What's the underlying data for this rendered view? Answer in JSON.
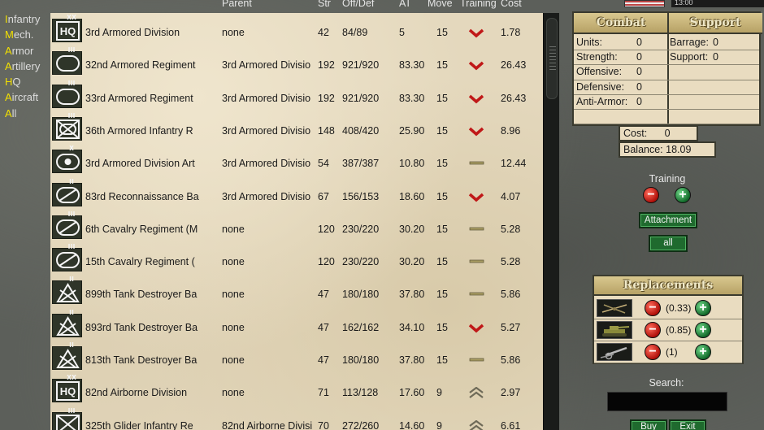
{
  "filters": [
    {
      "hot": "I",
      "rest": "nfantry"
    },
    {
      "hot": "M",
      "rest": "ech."
    },
    {
      "hot": "A",
      "rest": "rmor"
    },
    {
      "hot": "A",
      "rest": "rtillery"
    },
    {
      "hot": "H",
      "rest": "Q"
    },
    {
      "hot": "A",
      "rest": "ircraft"
    },
    {
      "hot": "A",
      "rest": "ll"
    }
  ],
  "header": {
    "parent": "Parent",
    "str": "Str",
    "offdef": "Off/Def",
    "at": "AT",
    "move": "Move",
    "training": "Training",
    "cost": "Cost"
  },
  "units": [
    {
      "name": "3rd Armored Division",
      "parent": "none",
      "str": "42",
      "offdef": "84/89",
      "at": "5",
      "move": "15",
      "training": "down",
      "cost": "1.78",
      "icon": "hq",
      "echelon": "xx"
    },
    {
      "name": "32nd Armored Regiment",
      "parent": "3rd Armored Divisio",
      "str": "192",
      "offdef": "921/920",
      "at": "83.30",
      "move": "15",
      "training": "down",
      "cost": "26.43",
      "icon": "armor",
      "echelon": "iii"
    },
    {
      "name": "33rd Armored Regiment",
      "parent": "3rd Armored Divisio",
      "str": "192",
      "offdef": "921/920",
      "at": "83.30",
      "move": "15",
      "training": "down",
      "cost": "26.43",
      "icon": "armor",
      "echelon": "iii"
    },
    {
      "name": "36th Armored Infantry R",
      "parent": "3rd Armored Divisio",
      "str": "148",
      "offdef": "408/420",
      "at": "25.90",
      "move": "15",
      "training": "down",
      "cost": "8.96",
      "icon": "armored-infantry",
      "echelon": "iii"
    },
    {
      "name": "3rd Armored Division Art",
      "parent": "3rd Armored Divisio",
      "str": "54",
      "offdef": "387/387",
      "at": "10.80",
      "move": "15",
      "training": "flat",
      "cost": "12.44",
      "icon": "artillery",
      "echelon": "x"
    },
    {
      "name": "83rd Reconnaissance Ba",
      "parent": "3rd Armored Divisio",
      "str": "67",
      "offdef": "156/153",
      "at": "18.60",
      "move": "15",
      "training": "down",
      "cost": "4.07",
      "icon": "recon",
      "echelon": "ii"
    },
    {
      "name": "6th Cavalry Regiment (M",
      "parent": "none",
      "str": "120",
      "offdef": "230/220",
      "at": "30.20",
      "move": "15",
      "training": "flat",
      "cost": "5.28",
      "icon": "recon",
      "echelon": "iii"
    },
    {
      "name": "15th Cavalry Regiment (",
      "parent": "none",
      "str": "120",
      "offdef": "230/220",
      "at": "30.20",
      "move": "15",
      "training": "flat",
      "cost": "5.28",
      "icon": "recon",
      "echelon": "iii"
    },
    {
      "name": "899th Tank Destroyer Ba",
      "parent": "none",
      "str": "47",
      "offdef": "180/180",
      "at": "37.80",
      "move": "15",
      "training": "flat",
      "cost": "5.86",
      "icon": "tank-destroyer",
      "echelon": "ii"
    },
    {
      "name": "893rd Tank Destroyer Ba",
      "parent": "none",
      "str": "47",
      "offdef": "162/162",
      "at": "34.10",
      "move": "15",
      "training": "down",
      "cost": "5.27",
      "icon": "tank-destroyer",
      "echelon": "ii"
    },
    {
      "name": "813th Tank Destroyer Ba",
      "parent": "none",
      "str": "47",
      "offdef": "180/180",
      "at": "37.80",
      "move": "15",
      "training": "flat",
      "cost": "5.86",
      "icon": "tank-destroyer",
      "echelon": "ii"
    },
    {
      "name": "82nd Airborne Division",
      "parent": "none",
      "str": "71",
      "offdef": "113/128",
      "at": "17.60",
      "move": "9",
      "training": "up",
      "cost": "2.97",
      "icon": "hq",
      "echelon": "xx"
    },
    {
      "name": "325th Glider Infantry Re",
      "parent": "82nd Airborne Divisi",
      "str": "70",
      "offdef": "272/260",
      "at": "14.60",
      "move": "9",
      "training": "up",
      "cost": "6.61",
      "icon": "infantry",
      "echelon": "iii"
    }
  ],
  "top_readout": "13:00",
  "stats": {
    "combat_title": "Combat",
    "support_title": "Support",
    "combat": [
      {
        "label": "Units:",
        "value": "0"
      },
      {
        "label": "Strength:",
        "value": "0"
      },
      {
        "label": "Offensive:",
        "value": "0"
      },
      {
        "label": "Defensive:",
        "value": "0"
      },
      {
        "label": "Anti-Armor:",
        "value": "0"
      }
    ],
    "support": [
      {
        "label": "Barrage:",
        "value": "0"
      },
      {
        "label": "Support:",
        "value": "0"
      }
    ]
  },
  "cost": {
    "label": "Cost:",
    "value": "0"
  },
  "balance": {
    "label": "Balance:",
    "value": "18.09"
  },
  "training": {
    "label": "Training",
    "minus": "−",
    "plus": "+"
  },
  "buttons": {
    "attachment": "Attachment",
    "all": "all",
    "buy": "Buy",
    "exit": "Exit"
  },
  "replacements": {
    "title": "Replacements",
    "rows": [
      {
        "icon": "infantry-icon",
        "value": "(0.33)"
      },
      {
        "icon": "tank-icon",
        "value": "(0.85)"
      },
      {
        "icon": "artillery-gun-icon",
        "value": "(1)"
      }
    ]
  },
  "search": {
    "label": "Search:",
    "value": ""
  }
}
